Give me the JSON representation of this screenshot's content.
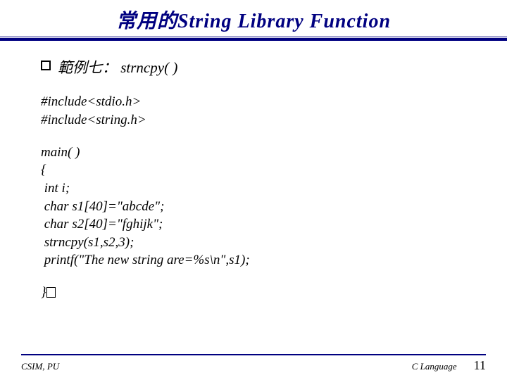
{
  "title": {
    "cjk": "常用的",
    "eng": "String Library Function"
  },
  "bullet": {
    "cjk_prefix": "範例七：",
    "code": "strncpy( )"
  },
  "includes": [
    "#include<stdio.h>",
    "#include<string.h>"
  ],
  "code_lines": [
    "main( )",
    "{",
    " int i;",
    " char s1[40]=\"abcde\";",
    " char s2[40]=\"fghijk\";",
    " strncpy(s1,s2,3);",
    " printf(\"The new string are=%s\\n\",s1);"
  ],
  "closing": "}",
  "footer": {
    "left": "CSIM, PU",
    "right_label": "C Language",
    "page": "11"
  }
}
